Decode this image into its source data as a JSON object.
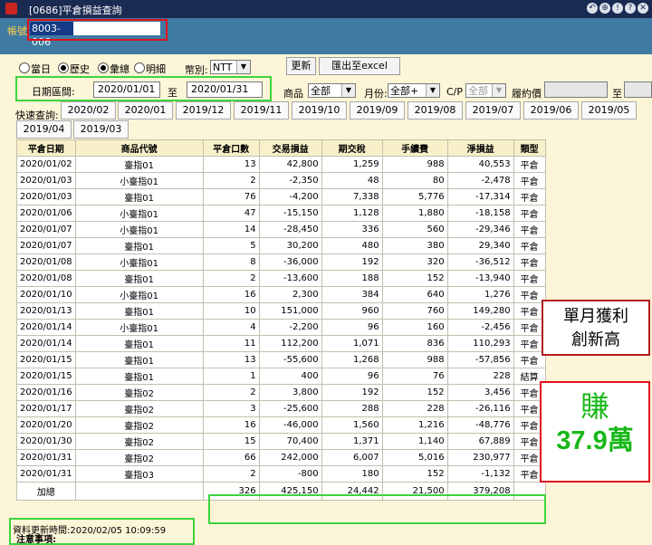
{
  "window": {
    "title": "[0686]平倉損益查詢",
    "controls": [
      "↶",
      "⊕",
      "!",
      "?",
      "✕"
    ]
  },
  "account": {
    "label": "帳號",
    "value": "8003-006"
  },
  "filters": {
    "mode_options": [
      "當日",
      "歷史"
    ],
    "mode_selected": "歷史",
    "detail_options": [
      "彙總",
      "明細"
    ],
    "detail_selected": "彙總",
    "currency_label": "幣別:",
    "currency_value": "NTT",
    "refresh_label": "更新",
    "export_label": "匯出至excel",
    "date_range_label": "日期區間:",
    "date_from": "2020/01/01",
    "date_to_sep": "至",
    "date_to": "2020/01/31",
    "product_label": "商品",
    "product_value": "全部",
    "month_label": "月份:",
    "month_value": "全部+",
    "cp_label": "C/P",
    "cp_value": "全部",
    "strike_label": "履約價",
    "strike_sep": "至"
  },
  "quick_query": {
    "label": "快速查詢:",
    "months": [
      "2020/02",
      "2020/01",
      "2019/12",
      "2019/11",
      "2019/10",
      "2019/09",
      "2019/08",
      "2019/07",
      "2019/06",
      "2019/05",
      "2019/04",
      "2019/03"
    ]
  },
  "table": {
    "headers": [
      "平倉日期",
      "商品代號",
      "平倉口數",
      "交易損益",
      "期交稅",
      "手續費",
      "淨損益",
      "類型"
    ],
    "rows": [
      [
        "2020/01/02",
        "臺指01",
        "13",
        "42,800",
        "1,259",
        "988",
        "40,553",
        "平倉"
      ],
      [
        "2020/01/03",
        "小臺指01",
        "2",
        "-2,350",
        "48",
        "80",
        "-2,478",
        "平倉"
      ],
      [
        "2020/01/03",
        "臺指01",
        "76",
        "-4,200",
        "7,338",
        "5,776",
        "-17,314",
        "平倉"
      ],
      [
        "2020/01/06",
        "小臺指01",
        "47",
        "-15,150",
        "1,128",
        "1,880",
        "-18,158",
        "平倉"
      ],
      [
        "2020/01/07",
        "小臺指01",
        "14",
        "-28,450",
        "336",
        "560",
        "-29,346",
        "平倉"
      ],
      [
        "2020/01/07",
        "臺指01",
        "5",
        "30,200",
        "480",
        "380",
        "29,340",
        "平倉"
      ],
      [
        "2020/01/08",
        "小臺指01",
        "8",
        "-36,000",
        "192",
        "320",
        "-36,512",
        "平倉"
      ],
      [
        "2020/01/08",
        "臺指01",
        "2",
        "-13,600",
        "188",
        "152",
        "-13,940",
        "平倉"
      ],
      [
        "2020/01/10",
        "小臺指01",
        "16",
        "2,300",
        "384",
        "640",
        "1,276",
        "平倉"
      ],
      [
        "2020/01/13",
        "臺指01",
        "10",
        "151,000",
        "960",
        "760",
        "149,280",
        "平倉"
      ],
      [
        "2020/01/14",
        "小臺指01",
        "4",
        "-2,200",
        "96",
        "160",
        "-2,456",
        "平倉"
      ],
      [
        "2020/01/14",
        "臺指01",
        "11",
        "112,200",
        "1,071",
        "836",
        "110,293",
        "平倉"
      ],
      [
        "2020/01/15",
        "臺指01",
        "13",
        "-55,600",
        "1,268",
        "988",
        "-57,856",
        "平倉"
      ],
      [
        "2020/01/15",
        "臺指01",
        "1",
        "400",
        "96",
        "76",
        "228",
        "結算"
      ],
      [
        "2020/01/16",
        "臺指02",
        "2",
        "3,800",
        "192",
        "152",
        "3,456",
        "平倉"
      ],
      [
        "2020/01/17",
        "臺指02",
        "3",
        "-25,600",
        "288",
        "228",
        "-26,116",
        "平倉"
      ],
      [
        "2020/01/20",
        "臺指02",
        "16",
        "-46,000",
        "1,560",
        "1,216",
        "-48,776",
        "平倉"
      ],
      [
        "2020/01/30",
        "臺指02",
        "15",
        "70,400",
        "1,371",
        "1,140",
        "67,889",
        "平倉"
      ],
      [
        "2020/01/31",
        "臺指02",
        "66",
        "242,000",
        "6,007",
        "5,016",
        "230,977",
        "平倉"
      ],
      [
        "2020/01/31",
        "臺指03",
        "2",
        "-800",
        "180",
        "152",
        "-1,132",
        "平倉"
      ]
    ],
    "total": [
      "加總",
      "",
      "326",
      "425,150",
      "24,442",
      "21,500",
      "379,208",
      ""
    ]
  },
  "footer": {
    "update_time": "資料更新時間:2020/02/05 10:09:59",
    "notice": "注意事項:"
  },
  "annotations": {
    "callout1_line1": "單月獲利",
    "callout1_line2": "創新高",
    "callout2_line1": "賺",
    "callout2_line2": "37.9萬"
  },
  "colors": {
    "titlebar": "#1a2b52",
    "accountbar": "#3f7aa2",
    "background": "#fdf5d7",
    "highlight_green": "#3cd43c",
    "highlight_red": "#e0121b"
  }
}
